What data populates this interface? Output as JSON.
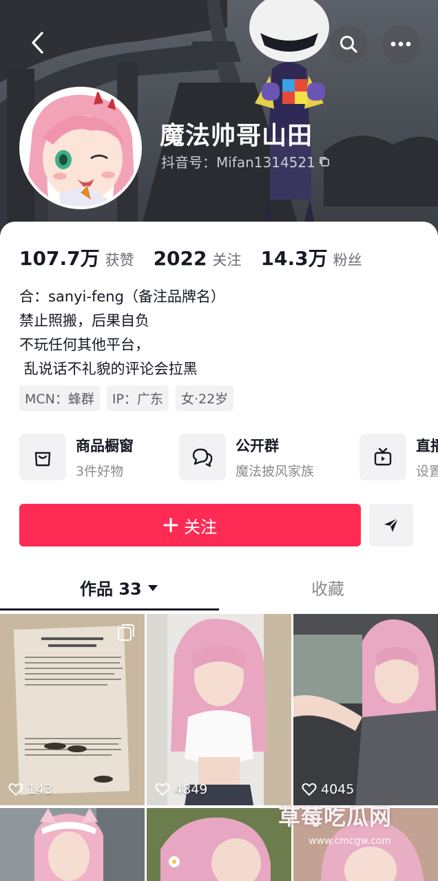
{
  "profile": {
    "nickname": "魔法帅哥山田",
    "douyin_id": "抖音号：Mifan1314521"
  },
  "stats": [
    {
      "value": "107.7万",
      "label": "获赞"
    },
    {
      "value": "2022",
      "label": "关注"
    },
    {
      "value": "14.3万",
      "label": "粉丝"
    }
  ],
  "bio": [
    "合：sanyi-feng（备注品牌名）",
    "禁止照搬，后果自负",
    "不玩任何其他平台，",
    " 乱说话不礼貌的评论会拉黑"
  ],
  "tags": [
    "MCN：蜂群",
    "IP：广东",
    "女·22岁"
  ],
  "features": [
    {
      "title": "商品橱窗",
      "subtitle": "3件好物",
      "icon": "shopping-bag-icon"
    },
    {
      "title": "公开群",
      "subtitle": "魔法披风家族",
      "icon": "group-chat-icon"
    },
    {
      "title": "直播",
      "subtitle": "设置",
      "icon": "tv-icon"
    }
  ],
  "actions": {
    "follow_label": "关注",
    "follow_color": "#fe2c55"
  },
  "tabs": {
    "works_label": "作品 33",
    "favorites_label": "收藏"
  },
  "posts": [
    {
      "likes": "143"
    },
    {
      "likes": "4849"
    },
    {
      "likes": "4045"
    }
  ],
  "watermark": {
    "title": "草莓吃瓜网",
    "url": "www.cmcgw.com"
  }
}
